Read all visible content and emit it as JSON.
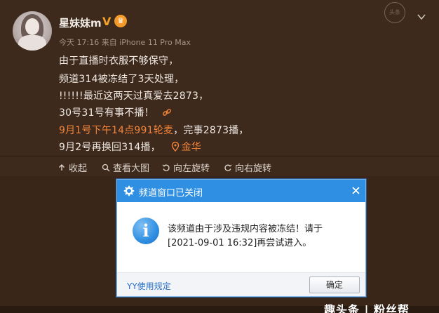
{
  "post": {
    "username": "星妹妹m",
    "verified_mark": "V",
    "crown_glyph": "♛",
    "meta": "今天 17:16 来自 iPhone 11 Pro Max",
    "stamp_text": "头条",
    "lines": {
      "l1": "由于直播时衣服不够保守，",
      "l2": "频道314被冻结了3天处理，",
      "l3": "!!!!!!最近这两天过真爱去2873，",
      "l4": "30号31号有事不播！",
      "l5_highlight": "9月1号下午14点991轮麦",
      "l5_rest": "，完事2873播，",
      "l6": "9月2号再换回314播，",
      "location": "金华"
    }
  },
  "actions": {
    "collect": "收起",
    "view_large": "查看大图",
    "rotate_left": "向左旋转",
    "rotate_right": "向右旋转"
  },
  "dialog": {
    "title": "频道窗口已关闭",
    "message_line1": "该频道由于涉及违规内容被冻结！请于",
    "message_line2": "[2021-09-01 16:32]再尝试进入。",
    "rules_link": "YY使用规定",
    "ok_button": "确定"
  },
  "watermark": "趣头条 | 粉丝帮",
  "colors": {
    "accent_orange": "#f4843a",
    "dialog_blue": "#2f8fe2",
    "background": "#3a2618"
  }
}
